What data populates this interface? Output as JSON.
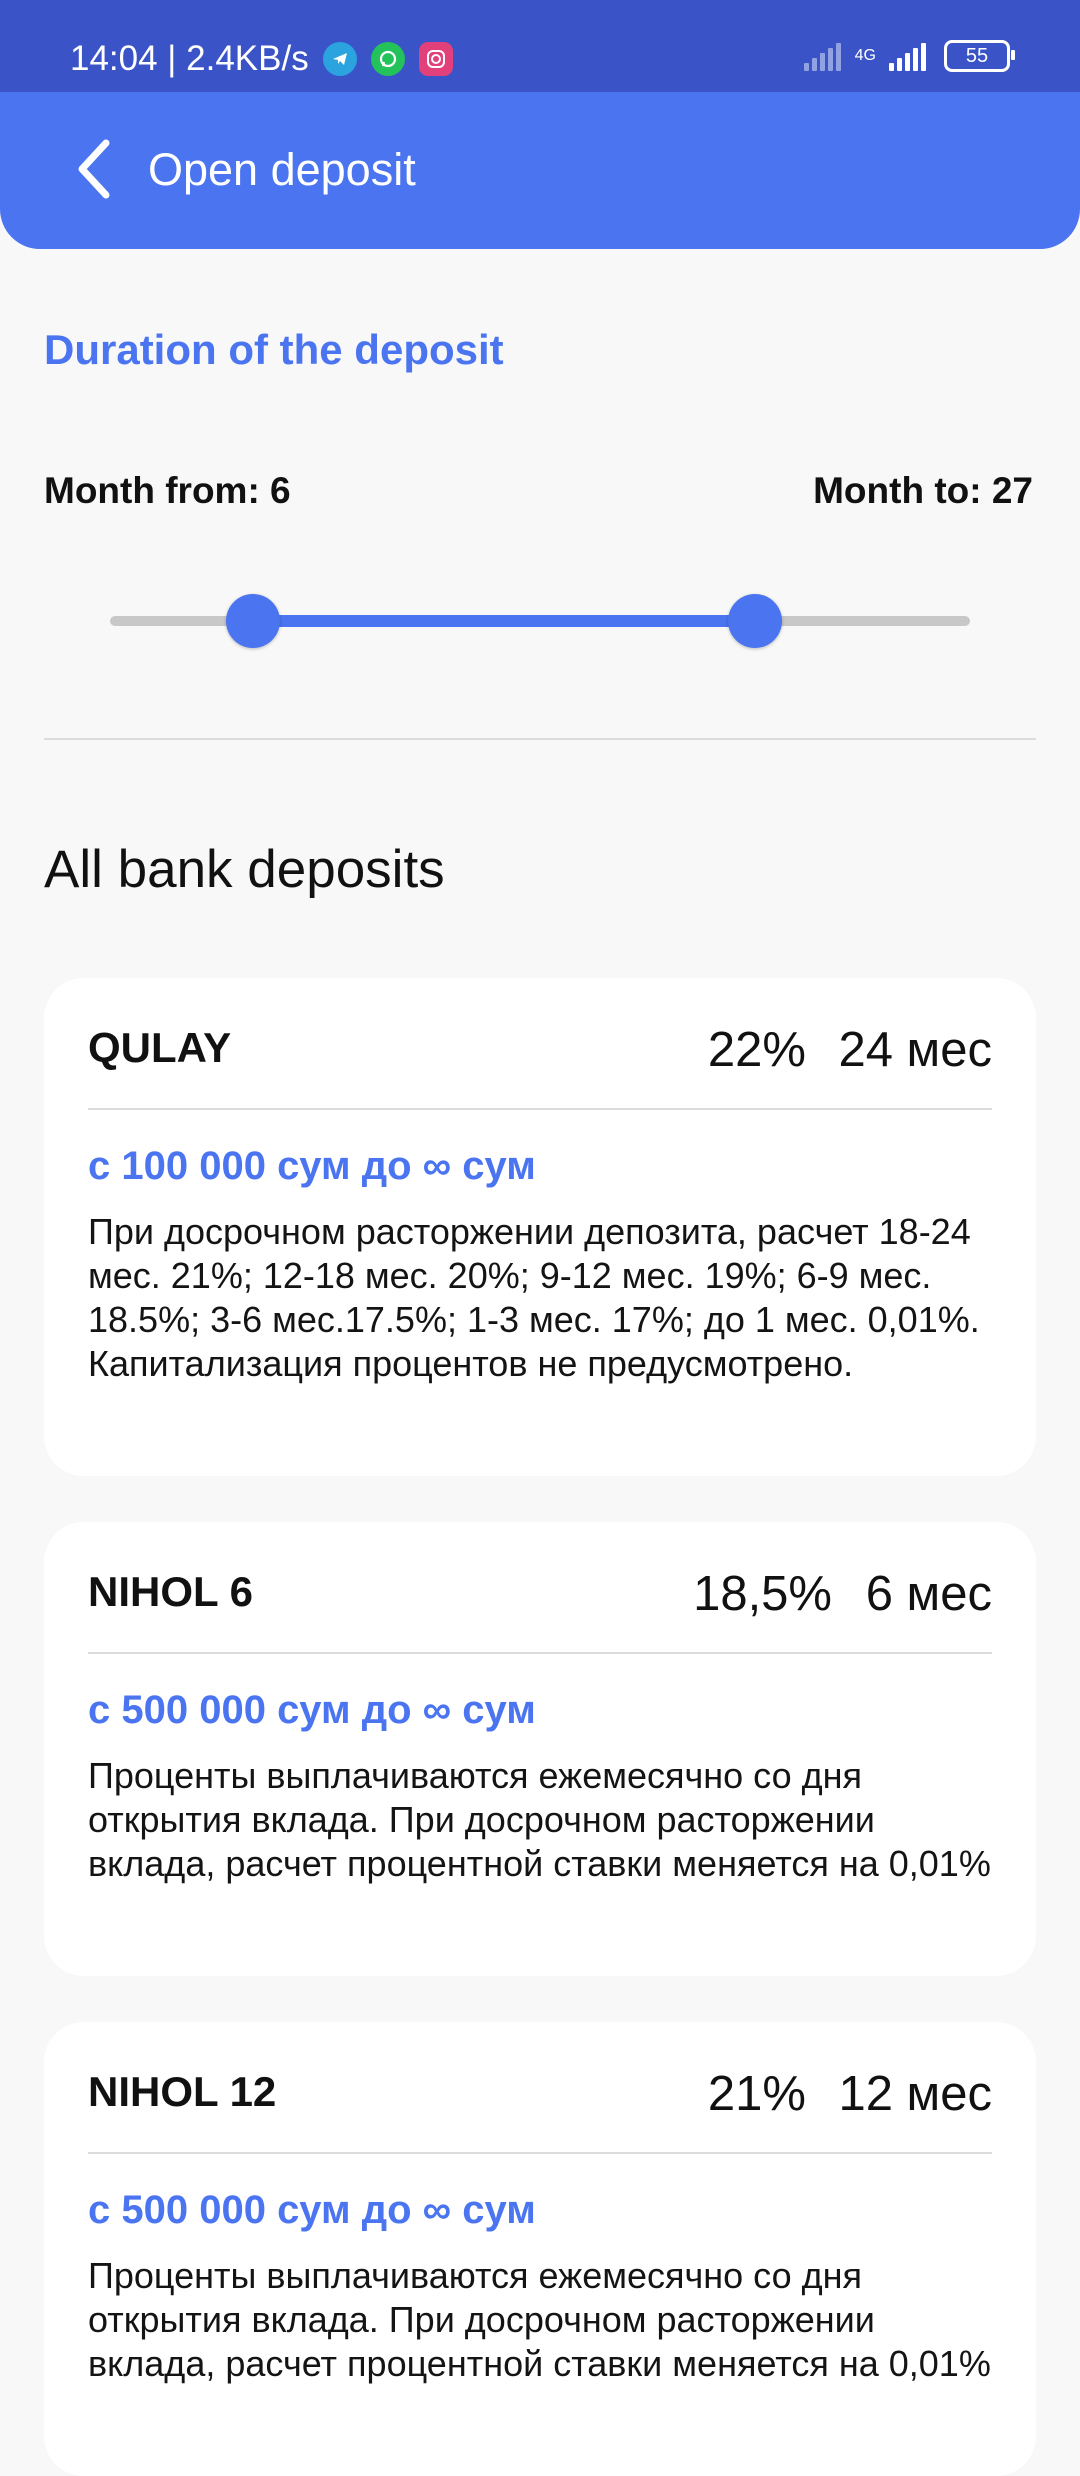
{
  "status_bar": {
    "time_speed": "14:04 | 2.4KB/s",
    "network": "4G",
    "battery": "55"
  },
  "header": {
    "title": "Open deposit"
  },
  "filter": {
    "section_title": "Duration of the deposit",
    "month_from_label": "Month from: 6",
    "month_to_label": "Month to: 27",
    "slider": {
      "min": 0,
      "max": 36,
      "from": 6,
      "to": 27
    }
  },
  "list_title": "All bank deposits",
  "deposits": [
    {
      "name": "QULAY",
      "rate": "22%",
      "term": "24 мес",
      "amount": "с 100 000 сум до ∞ сум",
      "description": "При досрочном расторжении депозита, расчет 18-24 мес. 21%; 12-18 мес. 20%; 9-12 мес. 19%; 6-9 мес. 18.5%; 3-6 мес.17.5%; 1-3 мес. 17%; до 1 мес. 0,01%. Капитализация процентов не предусмотрено."
    },
    {
      "name": "NIHOL 6",
      "rate": "18,5%",
      "term": "6 мес",
      "amount": "с 500 000 сум до ∞ сум",
      "description": "Проценты выплачиваются ежемесячно со дня открытия вклада. При досрочном расторжении вклада, расчет процентной ставки меняется на 0,01%"
    },
    {
      "name": "NIHOL 12",
      "rate": "21%",
      "term": "12 мес",
      "amount": "с 500 000 сум до ∞ сум",
      "description": "Проценты выплачиваются ежемесячно со дня открытия вклада. При досрочном расторжении вклада, расчет процентной ставки меняется на 0,01%"
    }
  ],
  "colors": {
    "primary": "#4b74f0",
    "status_bar": "#3a54c8",
    "background": "#f8f8f8",
    "card": "#ffffff"
  }
}
